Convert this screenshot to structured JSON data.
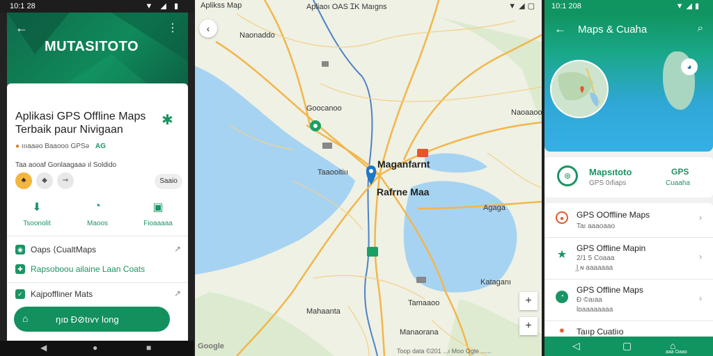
{
  "colors": {
    "brand_green": "#13905e",
    "map_water": "#a7d3f2",
    "map_road": "#f2b64a"
  },
  "panel1": {
    "status_time": "10:1 28",
    "header": {
      "brand": "MUTASITOTO",
      "back_icon": "arrow-back-icon",
      "more_icon": "more-vert-icon"
    },
    "title": "Aplikasi GPS Offline Maps Terbaik paur Nivigaan",
    "meta": "ıııaaəo Baaooo GPSə",
    "meta_tag": "AG",
    "desc": "Taa aooaf Gonlaagaaə ıl Soldido",
    "chip_pill": "Saaio",
    "actions": [
      {
        "label": "Tsoonolit",
        "icon": "download-icon"
      },
      {
        "label": "Maoos",
        "icon": "chat-icon"
      },
      {
        "label": "Fioaaaaa",
        "icon": "image-icon"
      }
    ],
    "rows": [
      {
        "label": "Oaps ⟨CualtMaps",
        "icon": "maps-icon"
      },
      {
        "label": "Rapsoboou ailaine Laan Coats",
        "icon": "map-pin-icon"
      },
      {
        "label": "Kajpoffliner Mats",
        "icon": "check-icon"
      }
    ],
    "fab_label": "ŋıɒ Ɖ⊘tıvʏ long",
    "nav": {
      "back": "◀",
      "home": "●",
      "recent": "■"
    }
  },
  "panel2": {
    "status_left": "Aplikss Map",
    "status_center": "Apliaoı OAS ꞮK Maıgns",
    "labels": [
      {
        "text": "Naonaddo",
        "class": ""
      },
      {
        "text": "Goocanoo",
        "class": ""
      },
      {
        "text": "Naoaaoo",
        "class": ""
      },
      {
        "text": "Maganfarnt",
        "class": "big"
      },
      {
        "text": "Taaooitiıı",
        "class": ""
      },
      {
        "text": "Rafrne Maa",
        "class": "big"
      },
      {
        "text": "Agaga",
        "class": ""
      },
      {
        "text": "Kataganı",
        "class": ""
      },
      {
        "text": "Tamaaoo",
        "class": ""
      },
      {
        "text": "Mahaanta",
        "class": ""
      },
      {
        "text": "Manaorana",
        "class": ""
      }
    ],
    "zoom_in": "+",
    "zoom_out": "+",
    "google": "Google",
    "attribution": "Toop data ©201 ...ı Moo Ogle ......"
  },
  "panel3": {
    "status_time": "10:1 208",
    "title": "Maps & Cuaha",
    "app": {
      "name": "Mapsıtoto",
      "sub": "GPS 0ıfiaps",
      "gps": "GPS",
      "gps_sub": "Cuaaha"
    },
    "items": [
      {
        "title": "GPS OOffline Maps",
        "line2": "Taı aaaoaao",
        "line3": "",
        "icon": "location-icon",
        "color": "#e2582c"
      },
      {
        "title": "GPS Offline Mapin",
        "line2": "2/1 5 Coaaa",
        "line3": "Ɩ̲ ɴ aaaaaaa",
        "icon": "star-icon",
        "color": "#1a9463"
      },
      {
        "title": "GPS Offline Maps",
        "line2": "Ɖ ©aıaa",
        "line3": "Ɩɒaaaaaaaa",
        "icon": "chat-icon",
        "color": "#1a9463"
      },
      {
        "title": "Taııp Cuatiıo",
        "line2": "",
        "line3": "",
        "icon": "sun-icon",
        "color": "#e2582c"
      }
    ],
    "nav_small": "aaa Oaao"
  }
}
